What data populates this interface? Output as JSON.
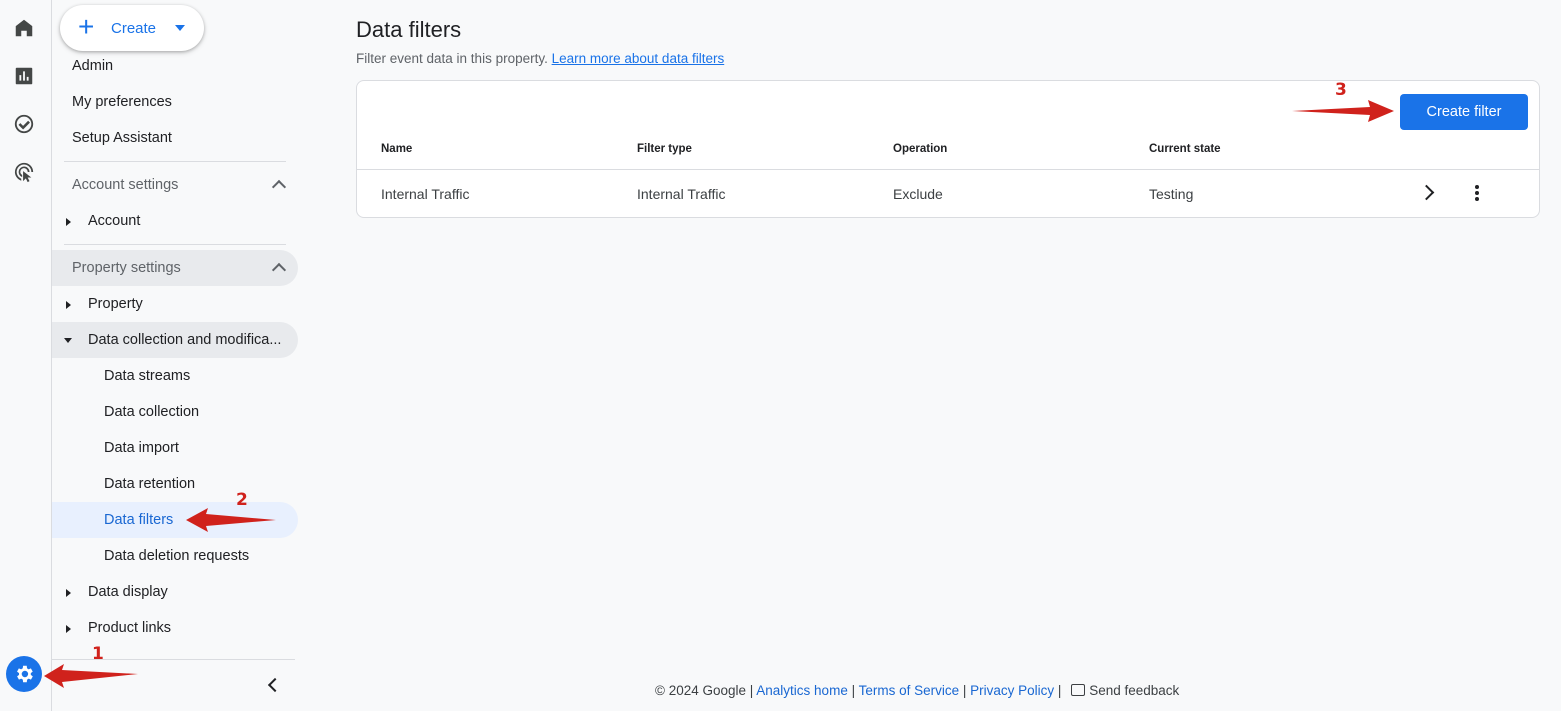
{
  "rail": {
    "icons": [
      "home-icon",
      "reports-icon",
      "explore-icon",
      "advertising-icon"
    ],
    "settings_icon": "gear-icon"
  },
  "nav": {
    "create_label": "Create",
    "top_items": [
      "Admin",
      "My preferences",
      "Setup Assistant"
    ],
    "account_settings": "Account settings",
    "account": "Account",
    "property_settings": "Property settings",
    "property": "Property",
    "data_collection": "Data collection and modifica...",
    "sub_items": [
      "Data streams",
      "Data collection",
      "Data import",
      "Data retention",
      "Data filters",
      "Data deletion requests"
    ],
    "data_display": "Data display",
    "product_links": "Product links"
  },
  "main": {
    "title": "Data filters",
    "subtitle": "Filter event data in this property.",
    "learn_more": "Learn more about data filters",
    "create_button": "Create filter",
    "columns": [
      "Name",
      "Filter type",
      "Operation",
      "Current state"
    ],
    "rows": [
      {
        "name": "Internal Traffic",
        "type": "Internal Traffic",
        "operation": "Exclude",
        "state": "Testing"
      }
    ]
  },
  "footer": {
    "copyright": "© 2024 Google",
    "analytics_home": "Analytics home",
    "terms": "Terms of Service",
    "privacy": "Privacy Policy",
    "feedback": "Send feedback"
  },
  "annotations": {
    "step1": "1",
    "step2": "2",
    "step3": "3",
    "color": "#d0221c"
  },
  "colors": {
    "accent": "#1a73e8",
    "active_bg": "#e8f0fe"
  }
}
